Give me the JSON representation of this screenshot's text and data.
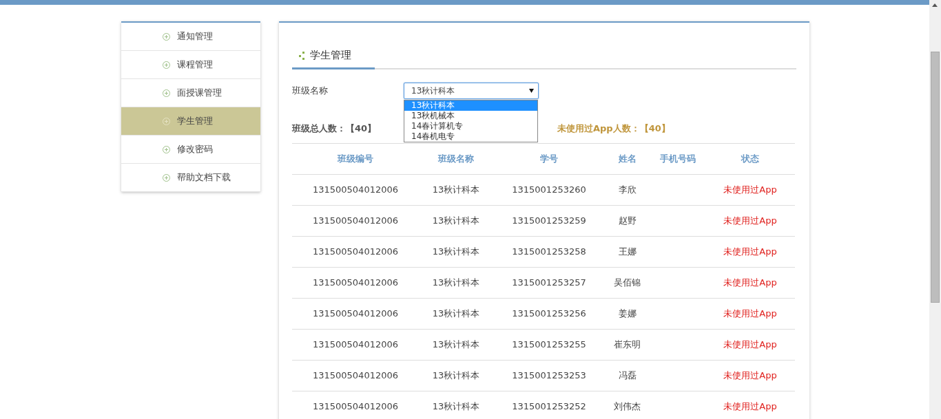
{
  "sidebar": {
    "items": [
      {
        "label": "通知管理",
        "selected": false
      },
      {
        "label": "课程管理",
        "selected": false
      },
      {
        "label": "面授课管理",
        "selected": false
      },
      {
        "label": "学生管理",
        "selected": true
      },
      {
        "label": "修改密码",
        "selected": false
      },
      {
        "label": "帮助文档下载",
        "selected": false
      }
    ]
  },
  "panel": {
    "title": "学生管理",
    "class_filter": {
      "label": "班级名称",
      "value": "13秋计科本",
      "expanded": true,
      "options": [
        {
          "label": "13秋计科本",
          "selected": true
        },
        {
          "label": "13秋机械本",
          "selected": false
        },
        {
          "label": "14春计算机专",
          "selected": false
        },
        {
          "label": "14春机电专",
          "selected": false
        }
      ]
    },
    "total_count": "班级总人数：【40】",
    "unused_count": "未使用过App人数：【40】",
    "table": {
      "columns": [
        "班级编号",
        "班级名称",
        "学号",
        "姓名",
        "手机号码",
        "状态"
      ],
      "rows": [
        [
          "131500504012006",
          "13秋计科本",
          "1315001253260",
          "李欣",
          "",
          "未使用过App"
        ],
        [
          "131500504012006",
          "13秋计科本",
          "1315001253259",
          "赵野",
          "",
          "未使用过App"
        ],
        [
          "131500504012006",
          "13秋计科本",
          "1315001253258",
          "王娜",
          "",
          "未使用过App"
        ],
        [
          "131500504012006",
          "13秋计科本",
          "1315001253257",
          "吴佰锦",
          "",
          "未使用过App"
        ],
        [
          "131500504012006",
          "13秋计科本",
          "1315001253256",
          "姜娜",
          "",
          "未使用过App"
        ],
        [
          "131500504012006",
          "13秋计科本",
          "1315001253255",
          "崔东明",
          "",
          "未使用过App"
        ],
        [
          "131500504012006",
          "13秋计科本",
          "1315001253253",
          "冯磊",
          "",
          "未使用过App"
        ],
        [
          "131500504012006",
          "13秋计科本",
          "1315001253252",
          "刘伟杰",
          "",
          "未使用过App"
        ]
      ]
    }
  }
}
